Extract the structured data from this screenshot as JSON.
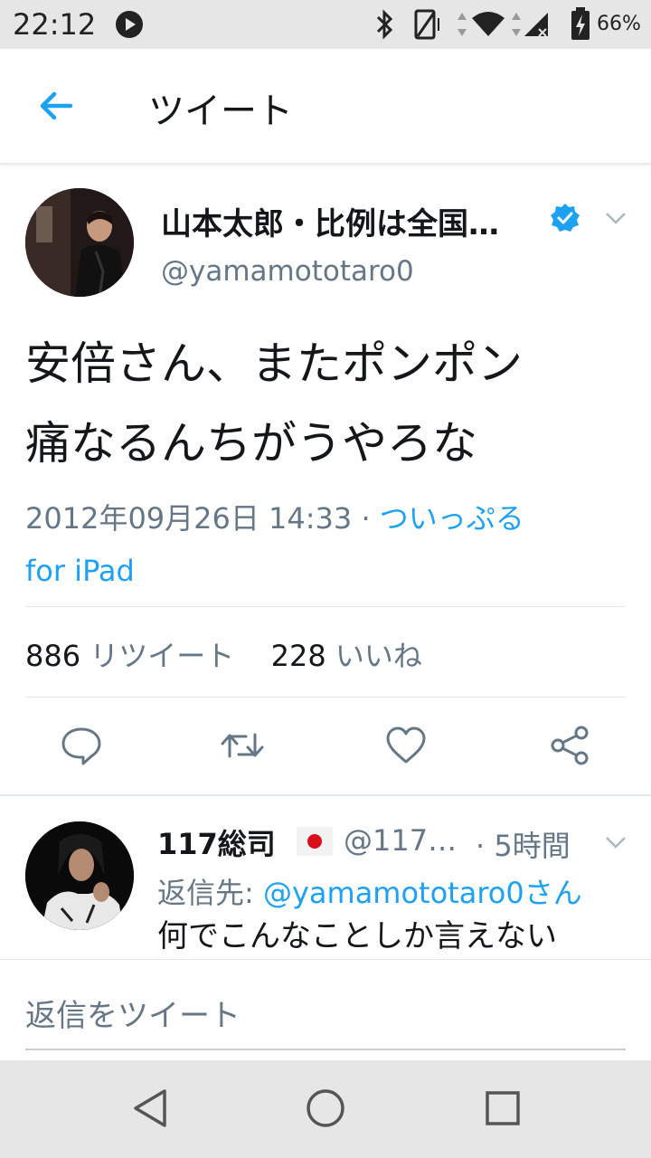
{
  "status_bar": {
    "time": "22:12",
    "battery_percent": "66%",
    "icons": [
      "play-icon",
      "bluetooth-icon",
      "vibrate-icon",
      "data-icon",
      "wifi-icon",
      "signal-icon",
      "battery-icon"
    ]
  },
  "app_bar": {
    "title": "ツイート",
    "back_icon": "arrow-left-icon"
  },
  "tweet": {
    "display_name": "山本太郎・比例は全国…",
    "verified": true,
    "handle": "@yamamototaro0",
    "text_line1": "安倍さん、またポンポン",
    "text_line2": "痛なるんちがうやろな",
    "datetime": "2012年09月26日 14:33",
    "separator": "·",
    "source_line1": "ついっぷる",
    "source_line2": "for iPad",
    "retweet_count": "886",
    "retweet_label": "リツイート",
    "like_count": "228",
    "like_label": "いいね",
    "actions": [
      "reply-icon",
      "retweet-icon",
      "like-icon",
      "share-icon"
    ]
  },
  "reply": {
    "display_name": "117総司",
    "flag": "japan-flag-icon",
    "handle": "@117…",
    "time": "· 5時間",
    "reply_to_label": "返信先:",
    "reply_to_mention": "@yamamototaro0さん",
    "text": "何でこんなことしか言えない"
  },
  "compose": {
    "placeholder": "返信をツイート"
  },
  "colors": {
    "accent": "#1da1f2",
    "text": "#14171a",
    "secondary": "#657786",
    "divider": "#e1e8ed",
    "system_bar": "#e6e6e6"
  }
}
